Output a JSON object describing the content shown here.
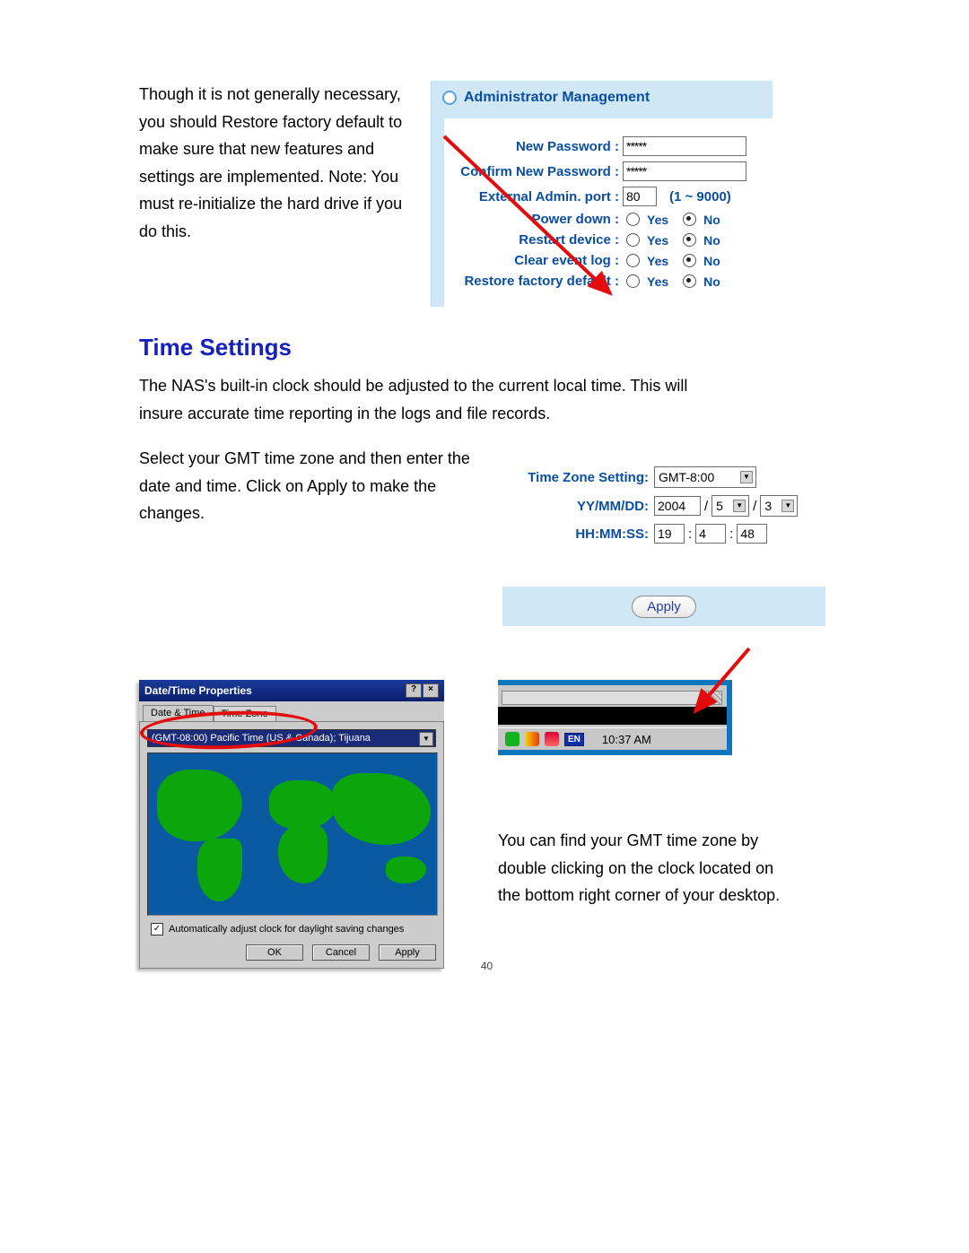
{
  "top_para": "Though it is not generally necessary, you should Restore factory default to make sure that new features and settings are implemented. Note: You must re-initialize the hard drive if you do this.",
  "admin": {
    "header": "Administrator Management",
    "new_pw_label": "New Password :",
    "new_pw_value": "*****",
    "confirm_pw_label": "Confirm New Password :",
    "confirm_pw_value": "*****",
    "ext_port_label": "External Admin. port :",
    "ext_port_value": "80",
    "ext_port_hint": "(1 ~ 9000)",
    "power_down_label": "Power down :",
    "restart_label": "Restart device :",
    "clear_log_label": "Clear event log :",
    "restore_label": "Restore factory default :",
    "yes": "Yes",
    "no": "No"
  },
  "heading_time": "Time Settings",
  "time_intro": "The NAS's built-in clock should be adjusted to the current local time. This will insure accurate time reporting in the logs and file records.",
  "time_para": "Select your GMT time zone and then enter the date and time. Click on Apply to make the changes.",
  "time": {
    "tz_label": "Time Zone Setting:",
    "tz_value": "GMT-8:00",
    "date_label": "YY/MM/DD:",
    "yy": "2004",
    "mm": "5",
    "dd": "3",
    "time_label": "HH:MM:SS:",
    "hh": "19",
    "min": "4",
    "ss": "48",
    "apply": "Apply"
  },
  "dialog": {
    "title": "Date/Time Properties",
    "tab1": "Date & Time",
    "tab2": "Time Zone",
    "tz_selected": "(GMT-08:00) Pacific Time (US & Canada); Tijuana",
    "dst_label": "Automatically adjust clock for daylight saving changes",
    "ok": "OK",
    "cancel": "Cancel",
    "apply": "Apply"
  },
  "taskbar": {
    "en": "EN",
    "clock": "10:37 AM"
  },
  "tz_para": "You can find your GMT time zone by double clicking on the clock located on the bottom right corner of your desktop.",
  "page_num": "40"
}
